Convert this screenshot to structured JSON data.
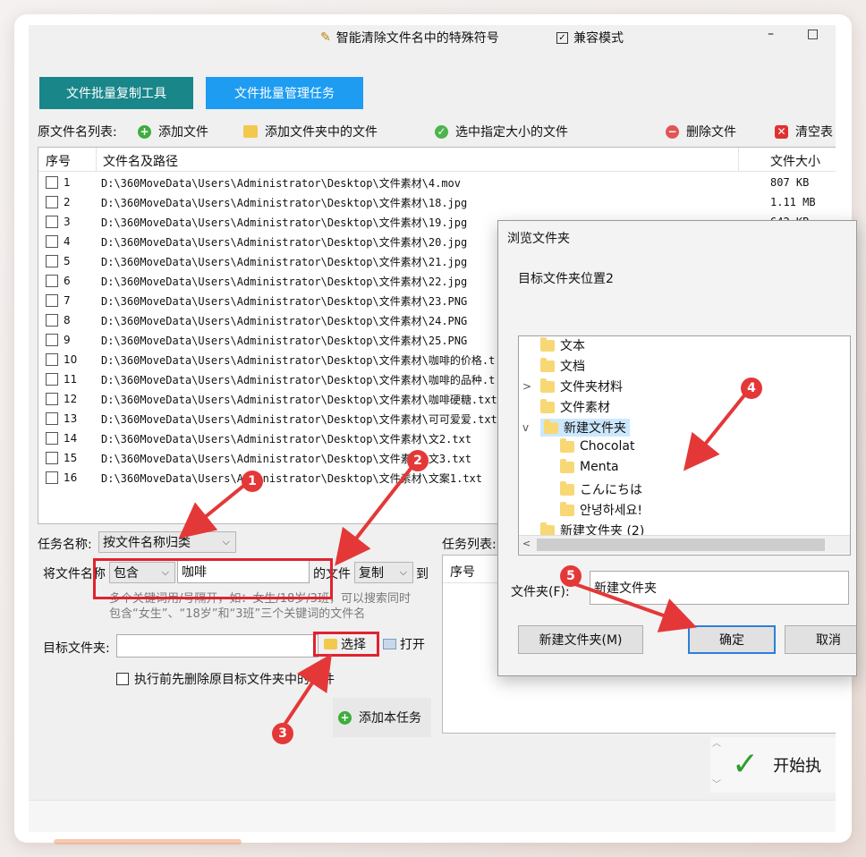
{
  "top": {
    "clean_special_label": "智能清除文件名中的特殊符号",
    "compat_label": "兼容模式",
    "minimize": "–",
    "maximize": "□"
  },
  "tabs": [
    {
      "label": "文件批量复制工具",
      "color": "#19868a"
    },
    {
      "label": "文件批量管理任务",
      "color": "#1d9cf2"
    }
  ],
  "toolbar": {
    "source_list_label": "原文件名列表:",
    "add_file": "添加文件",
    "add_folder_files": "添加文件夹中的文件",
    "select_by_size": "选中指定大小的文件",
    "delete_file": "删除文件",
    "clear_list": "清空表"
  },
  "file_list": {
    "headers": {
      "num": "序号",
      "path": "文件名及路径",
      "size": "文件大小"
    },
    "rows": [
      {
        "num": "1",
        "path": "D:\\360MoveData\\Users\\Administrator\\Desktop\\文件素材\\4.mov",
        "size": "807 KB"
      },
      {
        "num": "2",
        "path": "D:\\360MoveData\\Users\\Administrator\\Desktop\\文件素材\\18.jpg",
        "size": "1.11 MB"
      },
      {
        "num": "3",
        "path": "D:\\360MoveData\\Users\\Administrator\\Desktop\\文件素材\\19.jpg",
        "size": "642 KB"
      },
      {
        "num": "4",
        "path": "D:\\360MoveData\\Users\\Administrator\\Desktop\\文件素材\\20.jpg",
        "size": ""
      },
      {
        "num": "5",
        "path": "D:\\360MoveData\\Users\\Administrator\\Desktop\\文件素材\\21.jpg",
        "size": ""
      },
      {
        "num": "6",
        "path": "D:\\360MoveData\\Users\\Administrator\\Desktop\\文件素材\\22.jpg",
        "size": ""
      },
      {
        "num": "7",
        "path": "D:\\360MoveData\\Users\\Administrator\\Desktop\\文件素材\\23.PNG",
        "size": ""
      },
      {
        "num": "8",
        "path": "D:\\360MoveData\\Users\\Administrator\\Desktop\\文件素材\\24.PNG",
        "size": ""
      },
      {
        "num": "9",
        "path": "D:\\360MoveData\\Users\\Administrator\\Desktop\\文件素材\\25.PNG",
        "size": ""
      },
      {
        "num": "10",
        "path": "D:\\360MoveData\\Users\\Administrator\\Desktop\\文件素材\\咖啡的价格.t",
        "size": ""
      },
      {
        "num": "11",
        "path": "D:\\360MoveData\\Users\\Administrator\\Desktop\\文件素材\\咖啡的品种.t",
        "size": ""
      },
      {
        "num": "12",
        "path": "D:\\360MoveData\\Users\\Administrator\\Desktop\\文件素材\\咖啡硬糖.txt",
        "size": ""
      },
      {
        "num": "13",
        "path": "D:\\360MoveData\\Users\\Administrator\\Desktop\\文件素材\\可可爱爱.txt",
        "size": ""
      },
      {
        "num": "14",
        "path": "D:\\360MoveData\\Users\\Administrator\\Desktop\\文件素材\\文2.txt",
        "size": ""
      },
      {
        "num": "15",
        "path": "D:\\360MoveData\\Users\\Administrator\\Desktop\\文件素材\\文3.txt",
        "size": ""
      },
      {
        "num": "16",
        "path": "D:\\360MoveData\\Users\\Administrator\\Desktop\\文件素材\\文案1.txt",
        "size": ""
      }
    ]
  },
  "task": {
    "name_label": "任务名称:",
    "name_value": "按文件名称归类",
    "filename_label": "将文件名称",
    "contains_value": "包含",
    "keyword_value": "咖啡",
    "of_file_label": "的文件",
    "action_value": "复制",
    "to_label": "到",
    "hint_line1": "多个关键词用/号隔开，如：女生/18岁/3班，可以搜索同时",
    "hint_line2": "包含“女生”、“18岁”和“3班”三个关键词的文件名",
    "target_label": "目标文件夹:",
    "target_value": "",
    "choose_button": "选择",
    "open_button": "打开",
    "delete_first_label": "执行前先删除原目标文件夹中的文件",
    "add_task_button": "添加本任务",
    "task_list_label": "任务列表:",
    "task_list_header": "序号",
    "start_button": "开始执"
  },
  "dialog": {
    "title": "浏览文件夹",
    "subtitle": "目标文件夹位置2",
    "tree": [
      {
        "label": "文本",
        "level": 0,
        "expander": ""
      },
      {
        "label": "文档",
        "level": 0,
        "expander": ""
      },
      {
        "label": "文件夹材料",
        "level": 0,
        "expander": ">"
      },
      {
        "label": "文件素材",
        "level": 0,
        "expander": ""
      },
      {
        "label": "新建文件夹",
        "level": 0,
        "expander": "v",
        "selected": true
      },
      {
        "label": "Chocolat",
        "level": 1,
        "expander": ""
      },
      {
        "label": "Menta",
        "level": 1,
        "expander": ""
      },
      {
        "label": "こんにちは",
        "level": 1,
        "expander": ""
      },
      {
        "label": "안녕하세요!",
        "level": 1,
        "expander": ""
      },
      {
        "label": "新建文件夹 (2)",
        "level": 0,
        "expander": ""
      }
    ],
    "folder_label": "文件夹(F):",
    "folder_value": "新建文件夹",
    "new_folder_button": "新建文件夹(M)",
    "ok_button": "确定",
    "cancel_button": "取消"
  },
  "annotations": [
    "1",
    "2",
    "3",
    "4",
    "5"
  ]
}
